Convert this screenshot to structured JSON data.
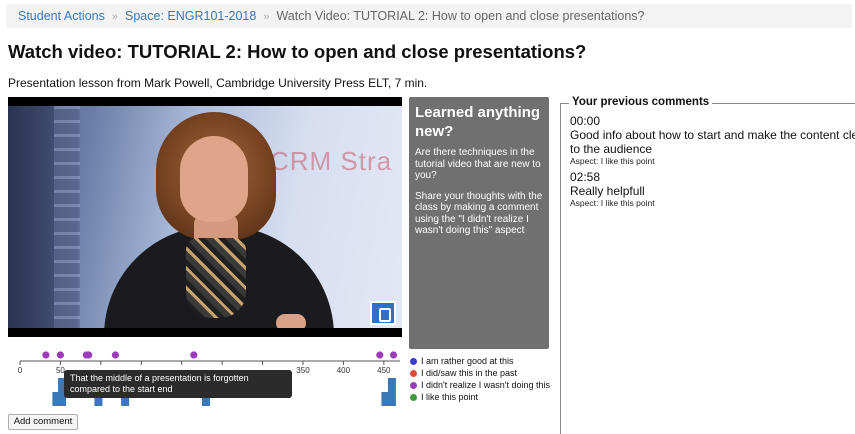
{
  "breadcrumb": {
    "items": [
      "Student Actions",
      "Space: ENGR101-2018"
    ],
    "current": "Watch Video: TUTORIAL 2: How to open and close presentations?",
    "separator": "»"
  },
  "page": {
    "title": "Watch video: TUTORIAL 2: How to open and close presentations?",
    "subtitle": "Presentation lesson from Mark Powell, Cambridge University Press ELT, 7 min."
  },
  "video": {
    "screen_text": "CRM Stra"
  },
  "learned_panel": {
    "title": "Learned anything new?",
    "text1": "Are there techniques in the tutorial video that are new to you?",
    "text2": "Share your thoughts with the class by making a comment using the \"I didn't realize I wasn't doing this\" aspect"
  },
  "timeline": {
    "axis_max": 470,
    "ticks": [
      0,
      50,
      350,
      400,
      450
    ],
    "markers": [
      {
        "t": 32,
        "color": "#9b3db8"
      },
      {
        "t": 50,
        "color": "#9b3db8"
      },
      {
        "t": 82,
        "color": "#9b3db8"
      },
      {
        "t": 85,
        "color": "#9b3db8"
      },
      {
        "t": 118,
        "color": "#9b3db8"
      },
      {
        "t": 215,
        "color": "#9b3db8"
      },
      {
        "t": 445,
        "color": "#9b3db8"
      },
      {
        "t": 462,
        "color": "#9b3db8"
      }
    ],
    "bars": [
      {
        "t": 45,
        "h": 14
      },
      {
        "t": 52,
        "h": 28
      },
      {
        "t": 97,
        "h": 14
      },
      {
        "t": 130,
        "h": 14
      },
      {
        "t": 230,
        "h": 14
      },
      {
        "t": 452,
        "h": 14
      },
      {
        "t": 460,
        "h": 28
      }
    ],
    "bar_color": "#3a78b8",
    "tooltip": "That the middle of a presentation is forgotten compared to the start end"
  },
  "legend": {
    "items": [
      {
        "label": "I am rather good at this",
        "color": "#3b3bd1"
      },
      {
        "label": "I did/saw this in the past",
        "color": "#e04a3a"
      },
      {
        "label": "I didn't realize I wasn't doing this",
        "color": "#9b3db8"
      },
      {
        "label": "I like this point",
        "color": "#3e9b3e"
      }
    ]
  },
  "actions": {
    "add_comment": "Add comment"
  },
  "previous_comments": {
    "title": "Your previous comments",
    "items": [
      {
        "time": "00:00",
        "text1": "Good info about how to start and make the content clear",
        "text2": "to the audience",
        "aspect": "Aspect: I like this point"
      },
      {
        "time": "02:58",
        "text1": "Really helpfull",
        "text2": "",
        "aspect": "Aspect: I like this point"
      }
    ]
  }
}
